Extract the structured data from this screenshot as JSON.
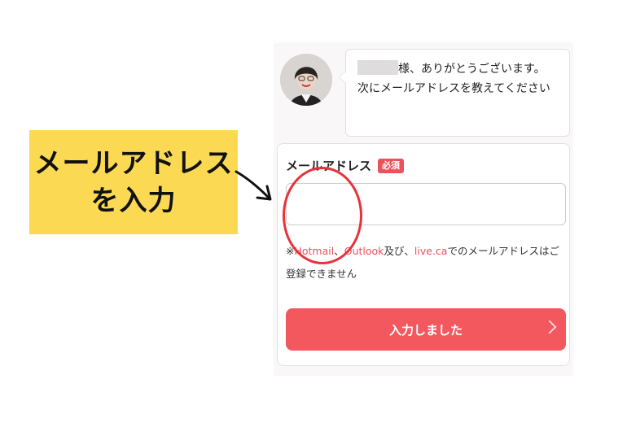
{
  "callout": {
    "line1": "メールアドレス",
    "line2": "を入力",
    "color": "#fbd953"
  },
  "chat": {
    "greeting_suffix": "様、ありがとうございます。",
    "message": "次にメールアドレスを教えてください"
  },
  "form": {
    "field_label": "メールアドレス",
    "required_badge": "必須",
    "email_value": "",
    "note_prefix": "※",
    "note_hotmail": "Hotmail",
    "note_sep": "、",
    "note_outlook": "Outlook",
    "note_and": "及び、",
    "note_live": "live.ca",
    "note_suffix": "でのメールアドレスはご登録できません",
    "submit_label": "入力しました"
  },
  "colors": {
    "accent": "#f3585f",
    "highlight_circle": "#e8323a",
    "link_red": "#e8535d"
  }
}
